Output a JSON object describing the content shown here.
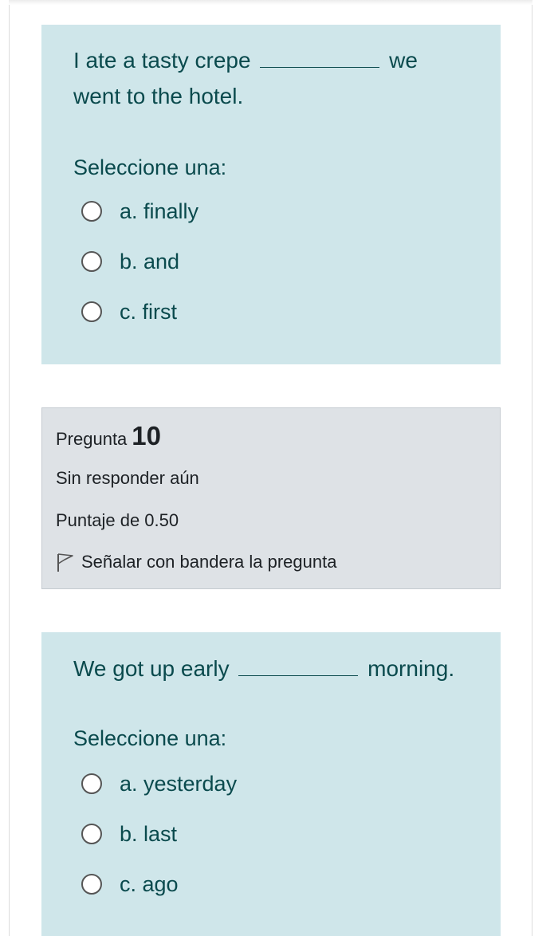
{
  "question9": {
    "text_before": "I ate a tasty crepe",
    "text_after_blank": "we",
    "text_line2": "went to the hotel.",
    "prompt": "Seleccione una:",
    "options": [
      {
        "label": "a. finally"
      },
      {
        "label": "b. and"
      },
      {
        "label": "c. first"
      }
    ]
  },
  "info": {
    "pregunta_label": "Pregunta",
    "number": "10",
    "status": "Sin responder aún",
    "score": "Puntaje de 0.50",
    "flag_label": "Señalar con bandera la pregunta",
    "flag_icon": "flag-outline-icon"
  },
  "question10": {
    "text_before": "We got up early",
    "text_after_blank": "morning.",
    "prompt": "Seleccione una:",
    "options": [
      {
        "label": "a. yesterday"
      },
      {
        "label": "b. last"
      },
      {
        "label": "c. ago"
      }
    ]
  },
  "colors": {
    "question_bg": "#cfe6ea",
    "question_text": "#0a4a4d",
    "info_bg": "#dee2e6"
  }
}
